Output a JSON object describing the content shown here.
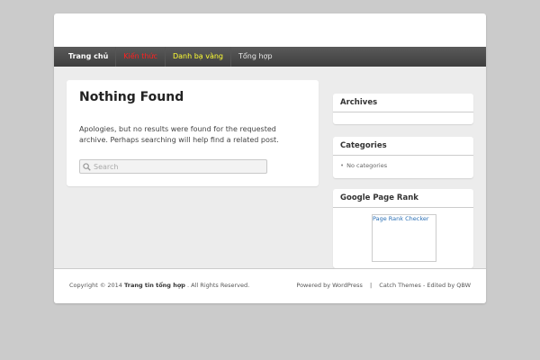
{
  "nav": {
    "items": [
      {
        "label": "Trang chủ",
        "color": "#ffffff",
        "bold": true
      },
      {
        "label": "Kiến thức",
        "color": "#ff2020",
        "bold": false
      },
      {
        "label": "Danh bạ vàng",
        "color": "#ffff33",
        "bold": false
      },
      {
        "label": "Tổng hợp",
        "color": "#e8e8e8",
        "bold": false
      }
    ]
  },
  "content": {
    "title": "Nothing Found",
    "text": "Apologies, but no results were found for the requested archive. Perhaps searching will help find a related post.",
    "search": {
      "placeholder": "Search",
      "value": "",
      "icon": "search-icon"
    }
  },
  "sidebar": {
    "archives": {
      "title": "Archives"
    },
    "categories": {
      "title": "Categories",
      "empty_text": "No categories"
    },
    "pagerank": {
      "title": "Google Page Rank",
      "link_label": "Page Rank Checker"
    }
  },
  "footer": {
    "copyright_prefix": "Copyright © 2014",
    "site_name": "Trang tin tổng hợp",
    "copyright_suffix": ". All Rights Reserved.",
    "powered": "Powered by WordPress",
    "divider": "|",
    "theme_credit": "Catch Themes - Edited by QBW"
  },
  "colors": {
    "accent_link": "#2a6fb5",
    "nav_bg": "#3e3e3e",
    "page_bg": "#cbcbcb"
  }
}
